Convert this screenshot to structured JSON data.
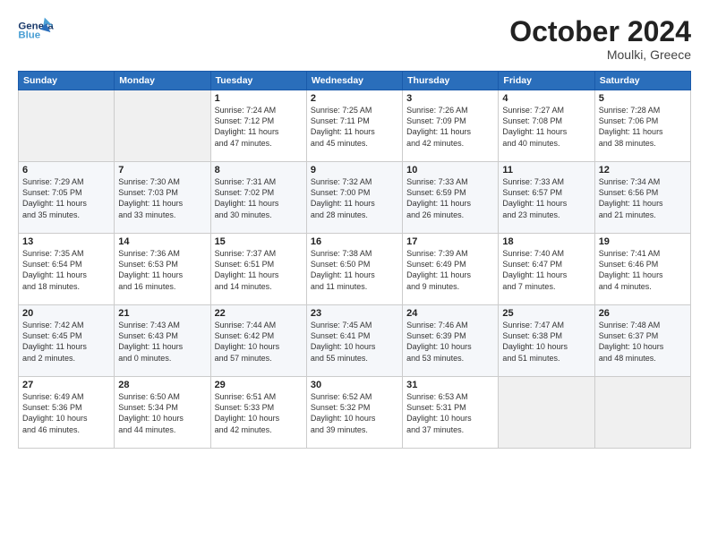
{
  "header": {
    "logo_general": "General",
    "logo_blue": "Blue",
    "month_title": "October 2024",
    "location": "Moulki, Greece"
  },
  "weekdays": [
    "Sunday",
    "Monday",
    "Tuesday",
    "Wednesday",
    "Thursday",
    "Friday",
    "Saturday"
  ],
  "weeks": [
    [
      {
        "day": "",
        "info": ""
      },
      {
        "day": "",
        "info": ""
      },
      {
        "day": "1",
        "info": "Sunrise: 7:24 AM\nSunset: 7:12 PM\nDaylight: 11 hours\nand 47 minutes."
      },
      {
        "day": "2",
        "info": "Sunrise: 7:25 AM\nSunset: 7:11 PM\nDaylight: 11 hours\nand 45 minutes."
      },
      {
        "day": "3",
        "info": "Sunrise: 7:26 AM\nSunset: 7:09 PM\nDaylight: 11 hours\nand 42 minutes."
      },
      {
        "day": "4",
        "info": "Sunrise: 7:27 AM\nSunset: 7:08 PM\nDaylight: 11 hours\nand 40 minutes."
      },
      {
        "day": "5",
        "info": "Sunrise: 7:28 AM\nSunset: 7:06 PM\nDaylight: 11 hours\nand 38 minutes."
      }
    ],
    [
      {
        "day": "6",
        "info": "Sunrise: 7:29 AM\nSunset: 7:05 PM\nDaylight: 11 hours\nand 35 minutes."
      },
      {
        "day": "7",
        "info": "Sunrise: 7:30 AM\nSunset: 7:03 PM\nDaylight: 11 hours\nand 33 minutes."
      },
      {
        "day": "8",
        "info": "Sunrise: 7:31 AM\nSunset: 7:02 PM\nDaylight: 11 hours\nand 30 minutes."
      },
      {
        "day": "9",
        "info": "Sunrise: 7:32 AM\nSunset: 7:00 PM\nDaylight: 11 hours\nand 28 minutes."
      },
      {
        "day": "10",
        "info": "Sunrise: 7:33 AM\nSunset: 6:59 PM\nDaylight: 11 hours\nand 26 minutes."
      },
      {
        "day": "11",
        "info": "Sunrise: 7:33 AM\nSunset: 6:57 PM\nDaylight: 11 hours\nand 23 minutes."
      },
      {
        "day": "12",
        "info": "Sunrise: 7:34 AM\nSunset: 6:56 PM\nDaylight: 11 hours\nand 21 minutes."
      }
    ],
    [
      {
        "day": "13",
        "info": "Sunrise: 7:35 AM\nSunset: 6:54 PM\nDaylight: 11 hours\nand 18 minutes."
      },
      {
        "day": "14",
        "info": "Sunrise: 7:36 AM\nSunset: 6:53 PM\nDaylight: 11 hours\nand 16 minutes."
      },
      {
        "day": "15",
        "info": "Sunrise: 7:37 AM\nSunset: 6:51 PM\nDaylight: 11 hours\nand 14 minutes."
      },
      {
        "day": "16",
        "info": "Sunrise: 7:38 AM\nSunset: 6:50 PM\nDaylight: 11 hours\nand 11 minutes."
      },
      {
        "day": "17",
        "info": "Sunrise: 7:39 AM\nSunset: 6:49 PM\nDaylight: 11 hours\nand 9 minutes."
      },
      {
        "day": "18",
        "info": "Sunrise: 7:40 AM\nSunset: 6:47 PM\nDaylight: 11 hours\nand 7 minutes."
      },
      {
        "day": "19",
        "info": "Sunrise: 7:41 AM\nSunset: 6:46 PM\nDaylight: 11 hours\nand 4 minutes."
      }
    ],
    [
      {
        "day": "20",
        "info": "Sunrise: 7:42 AM\nSunset: 6:45 PM\nDaylight: 11 hours\nand 2 minutes."
      },
      {
        "day": "21",
        "info": "Sunrise: 7:43 AM\nSunset: 6:43 PM\nDaylight: 11 hours\nand 0 minutes."
      },
      {
        "day": "22",
        "info": "Sunrise: 7:44 AM\nSunset: 6:42 PM\nDaylight: 10 hours\nand 57 minutes."
      },
      {
        "day": "23",
        "info": "Sunrise: 7:45 AM\nSunset: 6:41 PM\nDaylight: 10 hours\nand 55 minutes."
      },
      {
        "day": "24",
        "info": "Sunrise: 7:46 AM\nSunset: 6:39 PM\nDaylight: 10 hours\nand 53 minutes."
      },
      {
        "day": "25",
        "info": "Sunrise: 7:47 AM\nSunset: 6:38 PM\nDaylight: 10 hours\nand 51 minutes."
      },
      {
        "day": "26",
        "info": "Sunrise: 7:48 AM\nSunset: 6:37 PM\nDaylight: 10 hours\nand 48 minutes."
      }
    ],
    [
      {
        "day": "27",
        "info": "Sunrise: 6:49 AM\nSunset: 5:36 PM\nDaylight: 10 hours\nand 46 minutes."
      },
      {
        "day": "28",
        "info": "Sunrise: 6:50 AM\nSunset: 5:34 PM\nDaylight: 10 hours\nand 44 minutes."
      },
      {
        "day": "29",
        "info": "Sunrise: 6:51 AM\nSunset: 5:33 PM\nDaylight: 10 hours\nand 42 minutes."
      },
      {
        "day": "30",
        "info": "Sunrise: 6:52 AM\nSunset: 5:32 PM\nDaylight: 10 hours\nand 39 minutes."
      },
      {
        "day": "31",
        "info": "Sunrise: 6:53 AM\nSunset: 5:31 PM\nDaylight: 10 hours\nand 37 minutes."
      },
      {
        "day": "",
        "info": ""
      },
      {
        "day": "",
        "info": ""
      }
    ]
  ]
}
